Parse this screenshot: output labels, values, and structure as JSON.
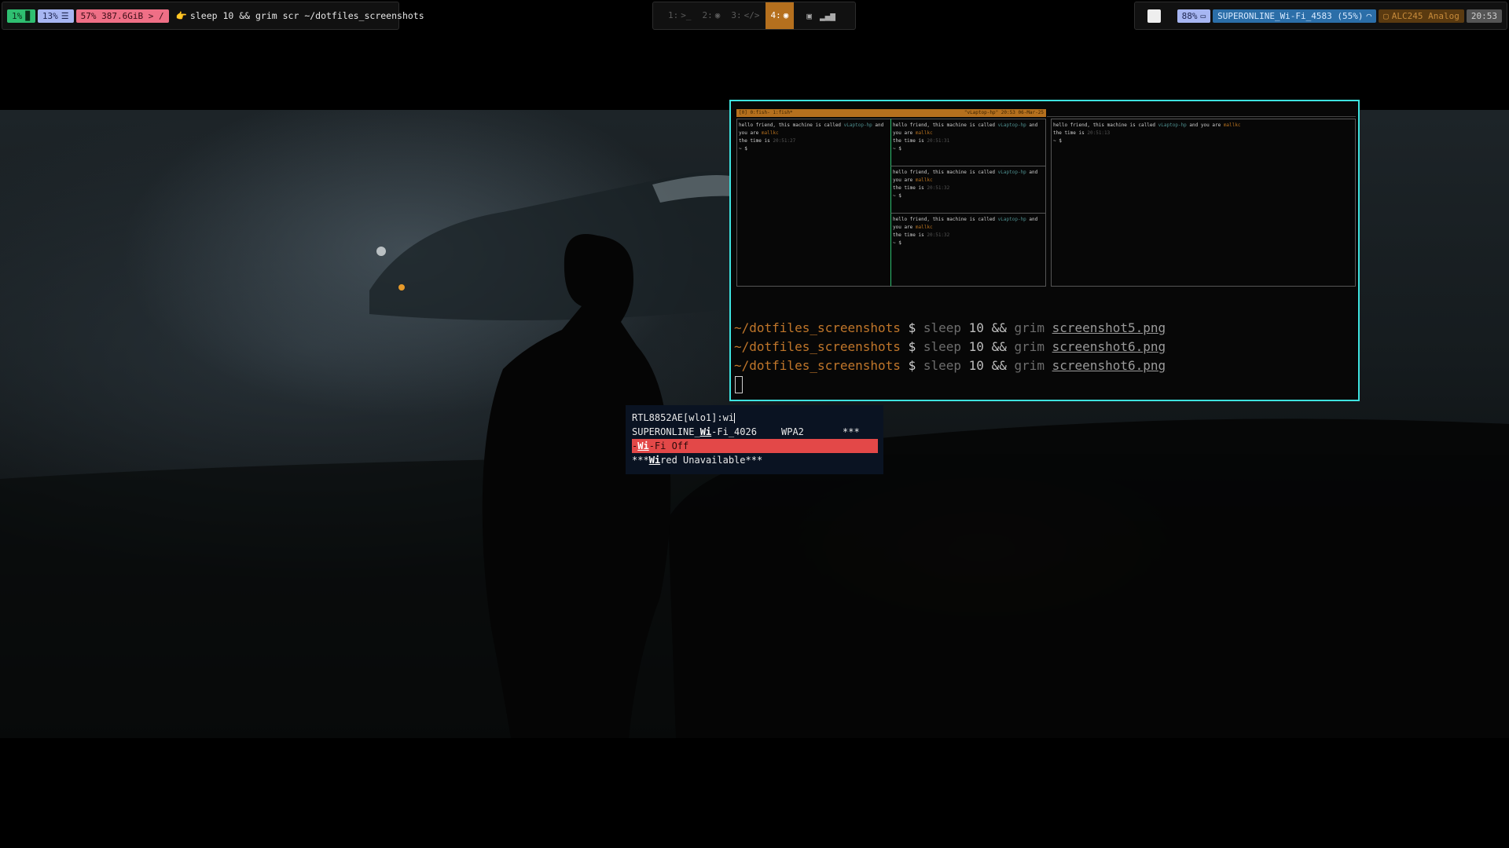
{
  "topbar": {
    "left": {
      "cpu": "1%",
      "mem": "13%",
      "disk": "57% 387.6GiB > /",
      "window_title_emoji": "👉",
      "window_title": "sleep 10 && grim scr ~/dotfiles_screenshots"
    },
    "workspaces": [
      {
        "label": "1:",
        "icon": ">_"
      },
      {
        "label": "2:",
        "icon": "◉"
      },
      {
        "label": "3:",
        "icon": "</>"
      },
      {
        "label": "4:",
        "icon": "◉",
        "active": true
      }
    ],
    "right": {
      "battery": "88%",
      "wifi": "SUPERONLINE_Wi-Fi_4583 (55%)",
      "audio": "ALC245 Analog",
      "clock": "20:53"
    }
  },
  "terminal": {
    "preview": {
      "tab_left": "[0] 0:fish- 1:fish*",
      "tab_right": "\"vLaptop-hp\" 20:53 06-Mar-25",
      "greeting": "hello friend, this machine is called",
      "host": "vLaptop-hp",
      "and": "and",
      "you_are": "you are",
      "user": "mallkc",
      "time_is": "the time is",
      "times": [
        "20:51:27",
        "20:51:31",
        "20:51:32",
        "20:51:32",
        "20:51:13"
      ],
      "prompt": "~ $"
    },
    "lines": [
      {
        "dir": "~/dotfiles_screenshots",
        "dollar": "$",
        "cmd": "sleep",
        "num": "10",
        "amp": "&&",
        "tool": "grim",
        "file": "screenshot5.png"
      },
      {
        "dir": "~/dotfiles_screenshots",
        "dollar": "$",
        "cmd": "sleep",
        "num": "10",
        "amp": "&&",
        "tool": "grim",
        "file": "screenshot6.png"
      },
      {
        "dir": "~/dotfiles_screenshots",
        "dollar": "$",
        "cmd": "sleep",
        "num": "10",
        "amp": "&&",
        "tool": "grim",
        "file": "screenshot6.png"
      }
    ]
  },
  "wifi_menu": {
    "prompt": "RTL8852AE[wlo1]:wi",
    "items": [
      {
        "pre": "SUPERONLINE_",
        "match": "Wi",
        "post": "-Fi_4026",
        "security": "WPA2",
        "signal": "***",
        "selected": false
      },
      {
        "pre": "-",
        "match": "Wi",
        "post": "-Fi Off",
        "security": "",
        "signal": "",
        "selected": true
      },
      {
        "pre": "***",
        "match": "Wi",
        "post": "red Unavailable***",
        "security": "",
        "signal": "",
        "selected": false
      }
    ]
  },
  "colors": {
    "terminal_border": "#3ee3e0",
    "accent": "#b5701e",
    "menu_selected": "#e34848",
    "menu_bg": "#0a1322"
  }
}
